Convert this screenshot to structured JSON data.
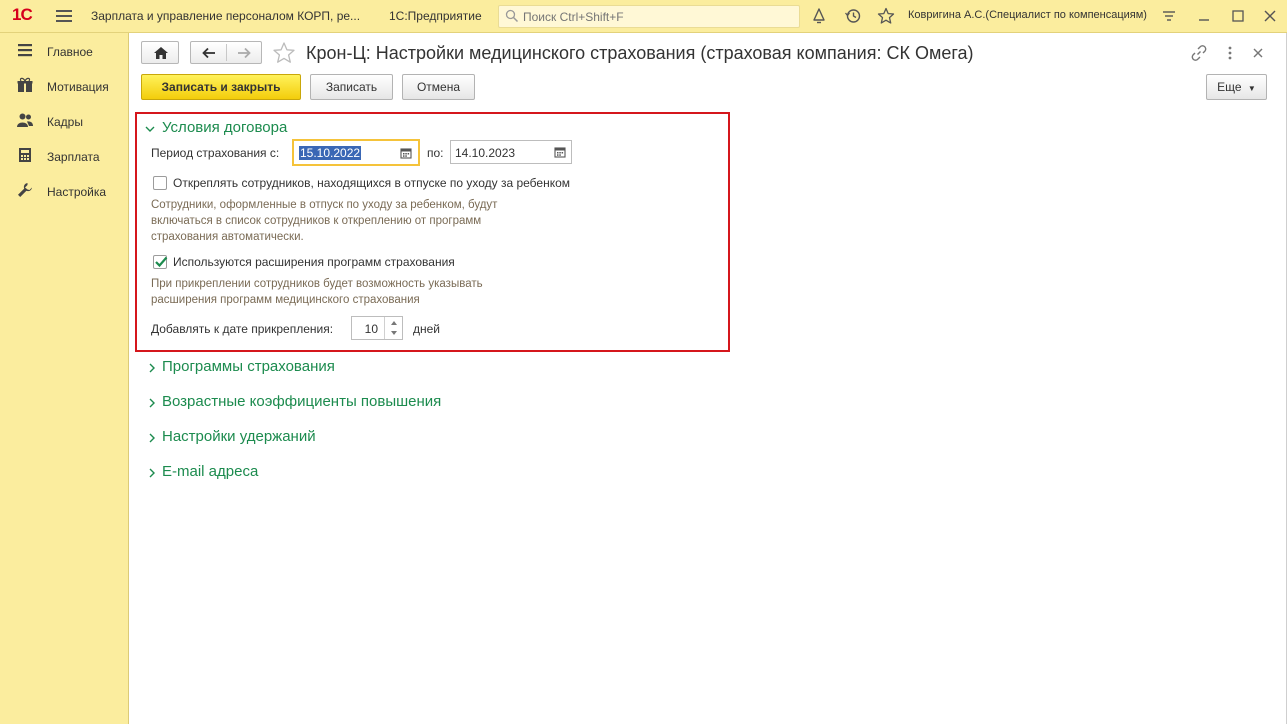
{
  "topbar": {
    "logo": "1С",
    "app_title": "Зарплата и управление персоналом КОРП, ре...",
    "platform": "1С:Предприятие",
    "search_placeholder": "Поиск Ctrl+Shift+F",
    "user": "Ковригина А.С.(Специалист по компенсациям)",
    "icons": [
      "bell-icon",
      "history-icon",
      "star-icon",
      "settings-lines-icon",
      "minimize-icon",
      "maximize-icon",
      "close-icon"
    ]
  },
  "sidebar": {
    "items": [
      {
        "label": "Главное",
        "icon": "menu-lines-icon"
      },
      {
        "label": "Мотивация",
        "icon": "gifts-icon"
      },
      {
        "label": "Кадры",
        "icon": "people-icon"
      },
      {
        "label": "Зарплата",
        "icon": "calculator-icon"
      },
      {
        "label": "Настройка",
        "icon": "wrench-icon"
      }
    ]
  },
  "form": {
    "title": "Крон-Ц: Настройки медицинского страхования (страховая компания: СК Омега)",
    "buttons": {
      "save_close": "Записать и закрыть",
      "save": "Записать",
      "cancel": "Отмена",
      "more": "Еще"
    },
    "contract_group": {
      "title": "Условия договора",
      "period_label": "Период страхования с:",
      "date_from": "15.10.2022",
      "to_label": "по:",
      "date_to": "14.10.2023",
      "detach_checkbox": {
        "label": "Откреплять сотрудников, находящихся в отпуске по уходу за ребенком",
        "checked": false,
        "hint": "Сотрудники, оформленные в отпуск по уходу за ребенком, будут\nвключаться в список сотрудников к откреплению от программ\nстрахования автоматически."
      },
      "extensions_checkbox": {
        "label": "Используются расширения программ страхования",
        "checked": true,
        "hint": "При прикреплении сотрудников будет возможность указывать\nрасширения программ медицинского страхования"
      },
      "add_days_label": "Добавлять к дате прикрепления:",
      "add_days_value": "10",
      "days_label": "дней"
    },
    "collapsed_groups": [
      "Программы страхования",
      "Возрастные коэффициенты повышения",
      "Настройки удержаний",
      "E-mail адреса"
    ]
  },
  "colors": {
    "panel": "#fbed9e",
    "accent_green": "#1c8b4e",
    "highlight_red": "#d5161c",
    "primary_button": "#f5d21c"
  }
}
